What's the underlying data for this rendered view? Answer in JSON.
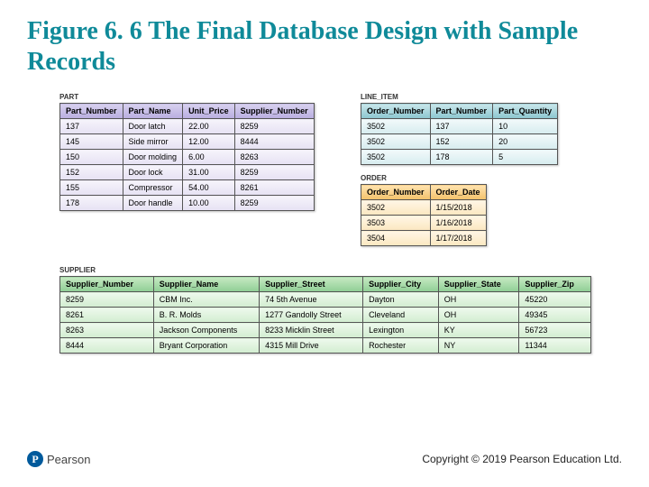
{
  "title": "Figure 6. 6 The Final Database Design with Sample Records",
  "part": {
    "label": "PART",
    "headers": [
      "Part_Number",
      "Part_Name",
      "Unit_Price",
      "Supplier_Number"
    ],
    "rows": [
      [
        "137",
        "Door latch",
        "22.00",
        "8259"
      ],
      [
        "145",
        "Side mirror",
        "12.00",
        "8444"
      ],
      [
        "150",
        "Door molding",
        "6.00",
        "8263"
      ],
      [
        "152",
        "Door lock",
        "31.00",
        "8259"
      ],
      [
        "155",
        "Compressor",
        "54.00",
        "8261"
      ],
      [
        "178",
        "Door handle",
        "10.00",
        "8259"
      ]
    ]
  },
  "line_item": {
    "label": "LINE_ITEM",
    "headers": [
      "Order_Number",
      "Part_Number",
      "Part_Quantity"
    ],
    "rows": [
      [
        "3502",
        "137",
        "10"
      ],
      [
        "3502",
        "152",
        "20"
      ],
      [
        "3502",
        "178",
        "5"
      ]
    ]
  },
  "order": {
    "label": "ORDER",
    "headers": [
      "Order_Number",
      "Order_Date"
    ],
    "rows": [
      [
        "3502",
        "1/15/2018"
      ],
      [
        "3503",
        "1/16/2018"
      ],
      [
        "3504",
        "1/17/2018"
      ]
    ]
  },
  "supplier": {
    "label": "SUPPLIER",
    "headers": [
      "Supplier_Number",
      "Supplier_Name",
      "Supplier_Street",
      "Supplier_City",
      "Supplier_State",
      "Supplier_Zip"
    ],
    "rows": [
      [
        "8259",
        "CBM Inc.",
        "74 5th Avenue",
        "Dayton",
        "OH",
        "45220"
      ],
      [
        "8261",
        "B. R. Molds",
        "1277 Gandolly Street",
        "Cleveland",
        "OH",
        "49345"
      ],
      [
        "8263",
        "Jackson Components",
        "8233 Micklin Street",
        "Lexington",
        "KY",
        "56723"
      ],
      [
        "8444",
        "Bryant Corporation",
        "4315 Mill Drive",
        "Rochester",
        "NY",
        "11344"
      ]
    ]
  },
  "footer": {
    "logo_mark": "P",
    "logo_text": "Pearson",
    "copyright": "Copyright © 2019 Pearson Education Ltd."
  }
}
